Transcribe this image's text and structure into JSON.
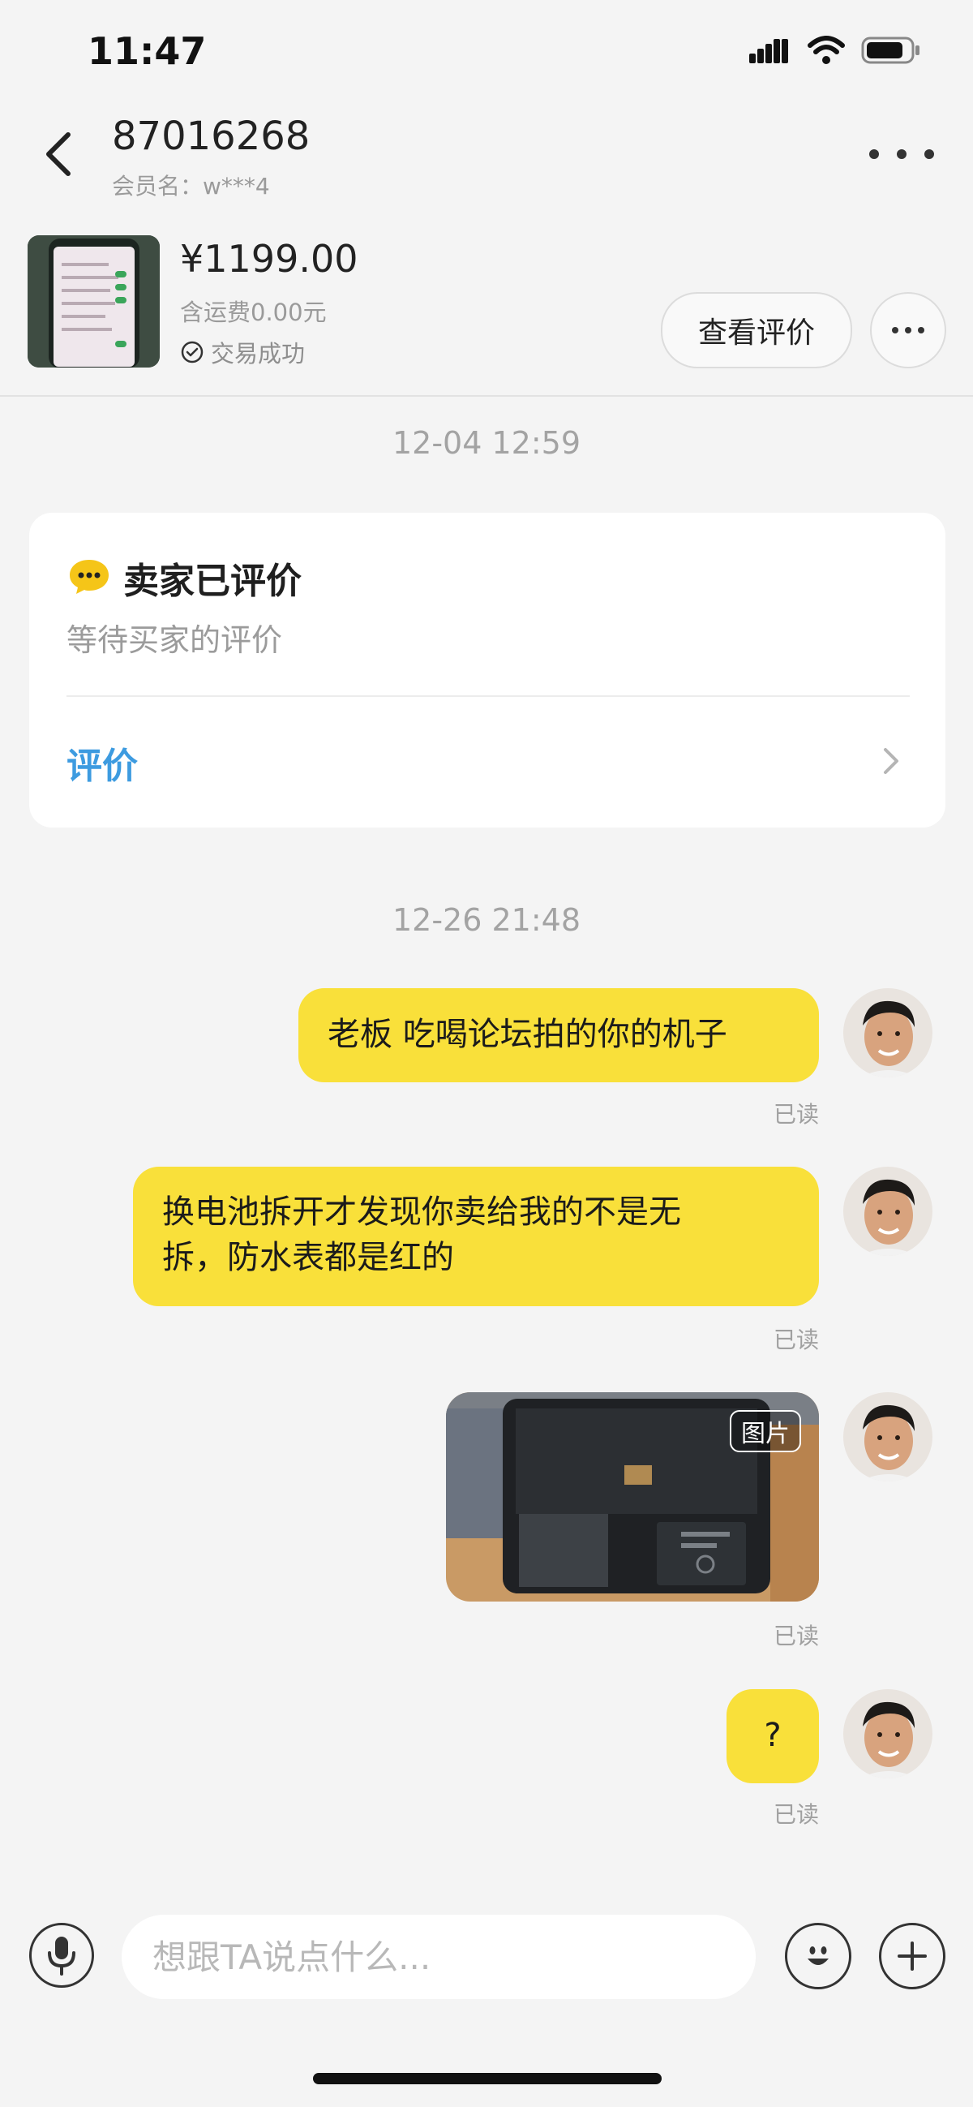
{
  "status_bar": {
    "time": "11:47"
  },
  "header": {
    "title": "87016268",
    "member_prefix": "会员名：",
    "member_name": "w***4"
  },
  "product": {
    "price": "¥1199.00",
    "shipping": "含运费0.00元",
    "status": "交易成功",
    "review_button": "查看评价"
  },
  "chat": {
    "timestamps": [
      "12-04 12:59",
      "12-26 21:48"
    ],
    "review_card": {
      "title": "卖家已评价",
      "subtitle": "等待买家的评价",
      "action": "评价"
    },
    "messages": [
      {
        "type": "text",
        "text": "老板 吃喝论坛拍的你的机子",
        "status": "已读"
      },
      {
        "type": "text",
        "line1": "换电池拆开才发现你卖给我的不是无",
        "line2": "拆，防水表都是红的",
        "status": "已读"
      },
      {
        "type": "image",
        "badge": "图片",
        "status": "已读"
      },
      {
        "type": "text",
        "text": "?",
        "status": "已读"
      }
    ]
  },
  "input_bar": {
    "placeholder": "想跟TA说点什么..."
  },
  "colors": {
    "bubble": "#f9e03a",
    "link": "#3d9be0",
    "background": "#f4f4f4"
  },
  "icons": [
    "back-icon",
    "more-icon",
    "check-circle-icon",
    "chat-bubble-icon",
    "chevron-right-icon",
    "microphone-icon",
    "emoji-icon",
    "plus-icon",
    "signal-icon",
    "wifi-icon",
    "battery-icon"
  ]
}
